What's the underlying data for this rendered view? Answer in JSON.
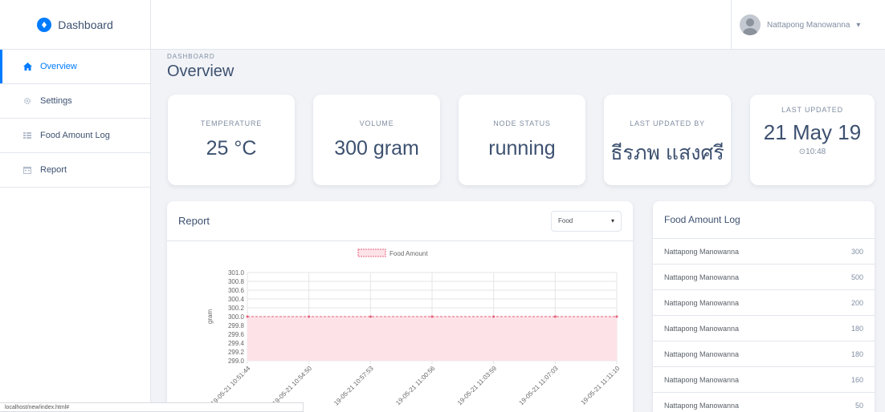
{
  "brand": {
    "label": "Dashboard",
    "icon": "brand-logo-icon"
  },
  "sidebar": {
    "items": [
      {
        "label": "Overview",
        "icon": "home-icon",
        "active": true
      },
      {
        "label": "Settings",
        "icon": "gear-icon",
        "active": false
      },
      {
        "label": "Food Amount Log",
        "icon": "table-icon",
        "active": false
      },
      {
        "label": "Report",
        "icon": "calendar-icon",
        "active": false
      }
    ]
  },
  "user": {
    "name": "Nattapong Manowanna",
    "caret": "▾"
  },
  "page": {
    "subtitle": "DASHBOARD",
    "title": "Overview"
  },
  "stats": [
    {
      "label": "Temperature",
      "value": "25 °C"
    },
    {
      "label": "Volume",
      "value": "300 gram"
    },
    {
      "label": "Node Status",
      "value": "running"
    },
    {
      "label": "Last Updated by",
      "value": "ธีรภพ แสงศรี"
    },
    {
      "label": "Last Updated",
      "value": "21 May 19",
      "sub": "⊙10:48"
    }
  ],
  "report": {
    "title": "Report",
    "select": {
      "value": "Food",
      "caret": "▾"
    }
  },
  "chart_data": {
    "type": "area",
    "legend": [
      "Food Amount"
    ],
    "legend_position": "top",
    "ylabel": "gram",
    "xlabel": "",
    "ylim": [
      299.0,
      301.0
    ],
    "yticks": [
      "301.0",
      "300.8",
      "300.6",
      "300.4",
      "300.2",
      "300.0",
      "299.8",
      "299.6",
      "299.4",
      "299.2",
      "299.0"
    ],
    "x": [
      "19-05-21 10:51:44",
      "19-05-21 10:54:50",
      "19-05-21 10:57:53",
      "19-05-21 11:00:56",
      "19-05-21 11:03:59",
      "19-05-21 11:07:03",
      "19-05-21 11:11:10"
    ],
    "series": [
      {
        "name": "Food Amount",
        "values": [
          300,
          300,
          300,
          300,
          300,
          300,
          300
        ]
      }
    ],
    "colors": {
      "fill": "#fde3e8",
      "stroke": "#e6607a"
    },
    "grid": true
  },
  "food_log": {
    "title": "Food Amount Log",
    "rows": [
      {
        "name": "Nattapong Manowanna",
        "amount": "300"
      },
      {
        "name": "Nattapong Manowanna",
        "amount": "500"
      },
      {
        "name": "Nattapong Manowanna",
        "amount": "200"
      },
      {
        "name": "Nattapong Manowanna",
        "amount": "180"
      },
      {
        "name": "Nattapong Manowanna",
        "amount": "180"
      },
      {
        "name": "Nattapong Manowanna",
        "amount": "160"
      },
      {
        "name": "Nattapong Manowanna",
        "amount": "50"
      }
    ]
  },
  "statusbar": {
    "url": "localhost/new/index.html#"
  },
  "colors": {
    "accent": "#007bff",
    "text": "#3d5170",
    "muted": "#818ea3"
  }
}
